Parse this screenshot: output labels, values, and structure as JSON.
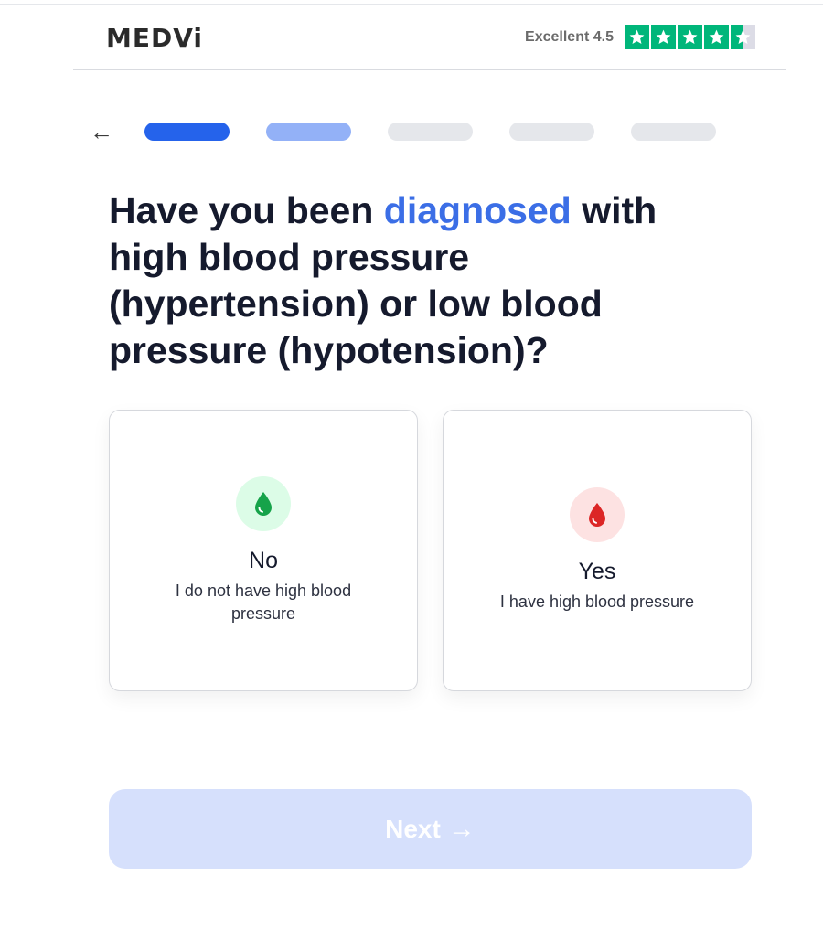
{
  "brand": {
    "logo_text": "MEDVi"
  },
  "rating": {
    "label": "Excellent 4.5",
    "value": 4.5,
    "max": 5,
    "star_color": "#00b67a"
  },
  "navigation": {
    "back_icon": "arrow-left-icon",
    "back_glyph": "←"
  },
  "progress": {
    "total_steps": 5,
    "completed_steps": 1,
    "current_step": 2
  },
  "question": {
    "part1": "Have you been ",
    "highlight": "diagnosed",
    "part2": " with high blood pressure (hypertension) or low blood pressure (hypotension)?",
    "highlight_color": "#3b6ee6"
  },
  "options": [
    {
      "title": "No",
      "subtitle": "I do not have high blood pressure",
      "icon": "blood-drop-green-icon",
      "color": "#16a34a"
    },
    {
      "title": "Yes",
      "subtitle": "I have high blood pressure",
      "icon": "blood-drop-red-icon",
      "color": "#dc2626"
    }
  ],
  "next_button": {
    "label": "Next",
    "arrow": "→",
    "state": "disabled"
  }
}
